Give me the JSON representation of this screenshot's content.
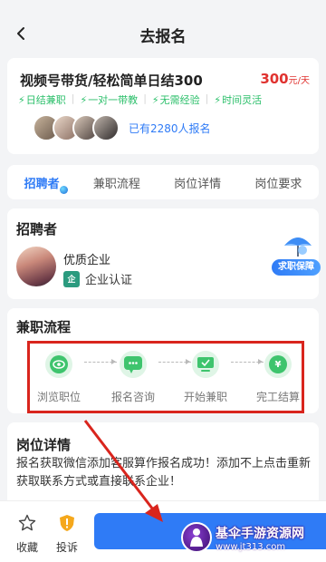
{
  "header": {
    "title": "去报名"
  },
  "job": {
    "title": "视频号带货/轻松简单日结300",
    "salary": "300",
    "salary_unit": "元/天",
    "tags": [
      "日结兼职",
      "一对一带教",
      "无需经验",
      "时间灵活"
    ],
    "applicants_text": "已有2280人报名"
  },
  "tabs": [
    "招聘者",
    "兼职流程",
    "岗位详情",
    "岗位要求"
  ],
  "recruiter": {
    "section_title": "招聘者",
    "company_name": "优质企业",
    "cert_icon": "企",
    "cert_label": "企业认证",
    "guarantee_label": "求职保障"
  },
  "process": {
    "section_title": "兼职流程",
    "steps": [
      {
        "label": "浏览职位",
        "icon": "eye-icon"
      },
      {
        "label": "报名咨询",
        "icon": "chat-icon"
      },
      {
        "label": "开始兼职",
        "icon": "monitor-icon"
      },
      {
        "label": "完工结算",
        "icon": "yen-icon"
      }
    ]
  },
  "details": {
    "section_title": "岗位详情",
    "text": "报名获取微信添加客服算作报名成功！添加不上点击重新获取联系方式或直接联系企业！"
  },
  "bottom": {
    "favorite_label": "收藏",
    "report_label": "投诉"
  },
  "watermark": {
    "title": "基伞手游资源网",
    "url": "www.jt313.com"
  },
  "colors": {
    "accent": "#2f7bf6",
    "salary": "#e0322f",
    "green": "#3ec46d",
    "annotation": "#d9251d"
  }
}
